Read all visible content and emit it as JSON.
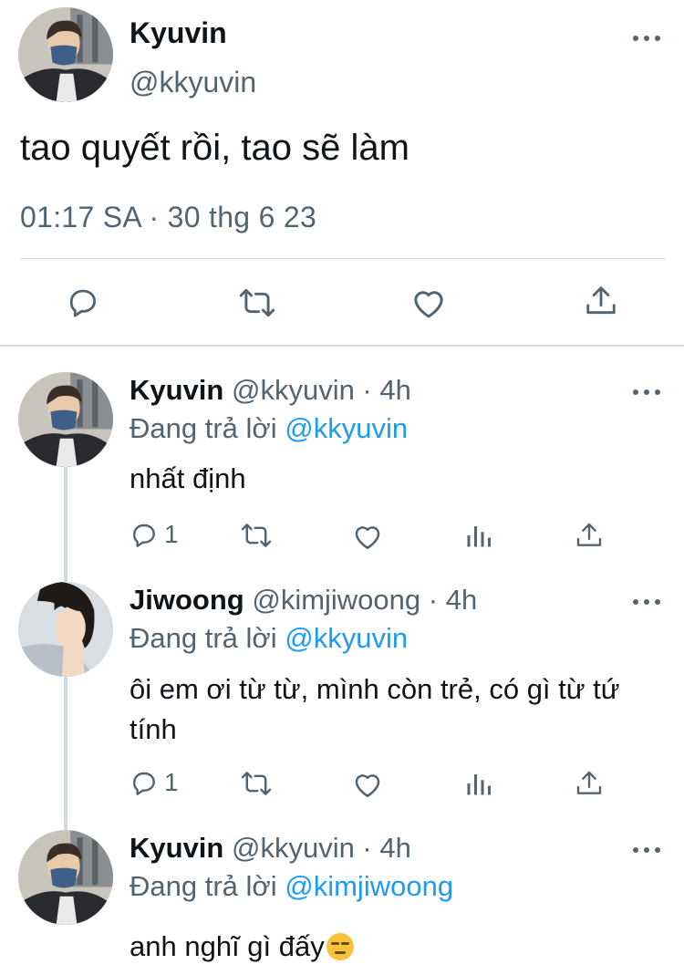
{
  "main_tweet": {
    "name": "Kyuvin",
    "handle": "@kkyuvin",
    "text": "tao quyết rồi, tao sẽ làm",
    "timestamp": "01:17 SA · 30 thg 6 23"
  },
  "replies": [
    {
      "name": "Kyuvin",
      "handle": "@kkyuvin · 4h",
      "replying_label": "Đang trả lời",
      "replying_to": "@kkyuvin",
      "text": "nhất định",
      "reply_count": "1"
    },
    {
      "name": "Jiwoong",
      "handle": "@kimjiwoong · 4h",
      "replying_label": "Đang trả lời",
      "replying_to": "@kkyuvin",
      "text": "ôi em ơi từ từ, mình còn trẻ, có gì từ tứ tính",
      "reply_count": "1"
    },
    {
      "name": "Kyuvin",
      "handle": "@kkyuvin · 4h",
      "replying_label": "Đang trả lời",
      "replying_to": "@kimjiwoong",
      "text": "anh nghĩ gì đấy"
    }
  ],
  "icons": {
    "reply": "speech-bubble",
    "retweet": "retweet-arrows",
    "like": "heart",
    "views": "bar-chart",
    "share": "share-arrow",
    "more": "three-dots",
    "emoji": "expressionless-face"
  },
  "colors": {
    "text": "#0f1419",
    "secondary": "#536471",
    "link": "#1d9bf0",
    "divider": "#d8dde1"
  }
}
